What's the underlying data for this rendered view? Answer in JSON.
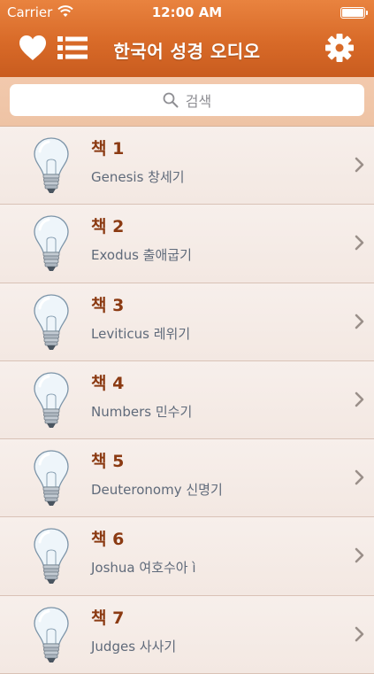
{
  "status_bar": {
    "carrier": "Carrier",
    "time": "12:00 AM"
  },
  "nav": {
    "title": "한국어 성경 오디오",
    "left_icons": [
      "heart-icon",
      "list-icon"
    ],
    "right_icon": "gear-icon"
  },
  "search": {
    "placeholder": "검색"
  },
  "books": [
    {
      "title": "책 1",
      "subtitle": "Genesis 창세기"
    },
    {
      "title": "책 2",
      "subtitle": "Exodus 출애굽기"
    },
    {
      "title": "책 3",
      "subtitle": "Leviticus 레위기"
    },
    {
      "title": "책 4",
      "subtitle": "Numbers 민수기"
    },
    {
      "title": "책 5",
      "subtitle": "Deuteronomy 신명기"
    },
    {
      "title": "책 6",
      "subtitle": "Joshua 여호수아 ì"
    },
    {
      "title": "책 7",
      "subtitle": "Judges 사사기"
    }
  ],
  "colors": {
    "nav_orange": "#d86a28",
    "search_band": "#f0c6a8",
    "title_brown": "#8b3a12",
    "subtitle_gray": "#5f6a7a"
  }
}
